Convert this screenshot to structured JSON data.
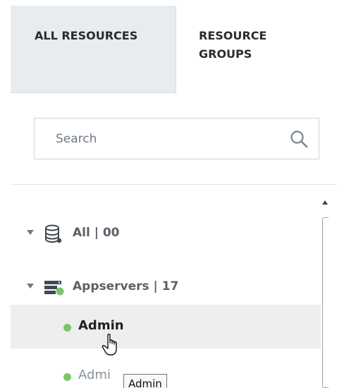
{
  "tabs": {
    "all": "ALL RESOURCES",
    "groups": "RESOURCE GROUPS"
  },
  "search": {
    "placeholder": "Search",
    "icon": "search-icon"
  },
  "tree": {
    "all": {
      "label": "All | 00",
      "icon": "database-icon"
    },
    "appservers": {
      "label": "Appservers | 17",
      "icon": "server-icon"
    },
    "leaves": [
      {
        "label": "Admin",
        "status_color": "#7cc46b"
      },
      {
        "label": "Admi",
        "status_color": "#7cc46b"
      }
    ]
  },
  "tooltip": {
    "text": "Admin"
  },
  "colors": {
    "tab_inactive_bg": "#e9ecef",
    "selected_row_bg": "#eceef0",
    "status_online": "#7cc46b",
    "server_icon_green": "#7cc46b"
  }
}
